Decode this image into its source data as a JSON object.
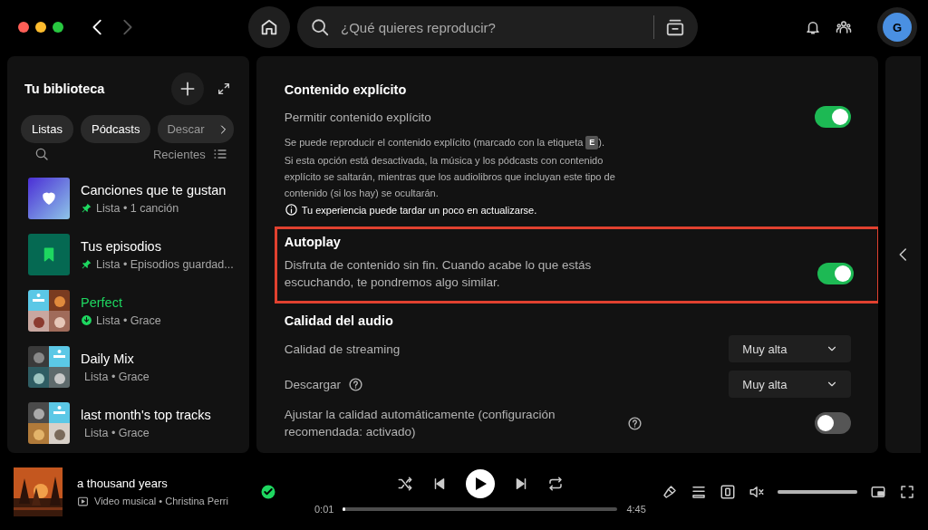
{
  "topbar": {
    "nav": [
      {
        "kind": "back",
        "disabled": false
      },
      {
        "kind": "forward",
        "disabled": true
      }
    ],
    "search": {
      "placeholder": "¿Qué quieres reproducir?"
    },
    "avatar": "G"
  },
  "library": {
    "title": "Tu biblioteca",
    "filters": [
      {
        "label": "Listas",
        "selected": false
      },
      {
        "label": "Pódcasts",
        "selected": false
      },
      {
        "label": "Descar",
        "selected": false
      }
    ],
    "sort": "Recientes",
    "items": [
      {
        "title": "Canciones que te gustan",
        "subtitle": "Lista • 1 canción",
        "kind": "liked",
        "pinned": true,
        "downloaded": false,
        "playing": false
      },
      {
        "title": "Tus episodios",
        "subtitle": "Lista • Episodios guardad...",
        "kind": "episodes",
        "pinned": true,
        "downloaded": false,
        "playing": false
      },
      {
        "title": "Perfect",
        "subtitle": "Lista • Grace",
        "kind": "picture",
        "pinned": false,
        "downloaded": true,
        "playing": true
      },
      {
        "title": "Daily Mix",
        "subtitle": "Lista • Grace",
        "kind": "picture",
        "pinned": false,
        "downloaded": false,
        "playing": false
      },
      {
        "title": "last month's top tracks",
        "subtitle": "Lista • Grace",
        "kind": "picture",
        "pinned": false,
        "downloaded": false,
        "playing": false
      }
    ]
  },
  "settings": {
    "sections": [
      {
        "title": "Contenido explícito",
        "highlighted": false,
        "items": [
          {
            "kind": "toggle",
            "label": "Permitir contenido explícito",
            "on": true,
            "help": false
          },
          {
            "kind": "badge_note",
            "before": "Se puede reproducir el contenido explícito (marcado con la etiqueta",
            "badge": "E",
            "after": ")."
          },
          {
            "kind": "note",
            "text": "Si esta opción está desactivada, la música y los pódcasts con contenido explícito se saltarán, mientras que los audiolibros que incluyan este tipo de contenido (si los hay) se ocultarán."
          },
          {
            "kind": "info",
            "text": "Tu experiencia puede tardar un poco en actualizarse."
          }
        ]
      },
      {
        "title": "Autoplay",
        "highlighted": true,
        "items": [
          {
            "kind": "toggle",
            "label": "Disfruta de contenido sin fin. Cuando acabe lo que estás escuchando, te pondremos algo similar.",
            "on": true,
            "help": false
          }
        ]
      },
      {
        "title": "Calidad del audio",
        "highlighted": false,
        "items": [
          {
            "kind": "select",
            "label": "Calidad de streaming",
            "value": "Muy alta",
            "help": false
          },
          {
            "kind": "select",
            "label": "Descargar",
            "value": "Muy alta",
            "help": true
          },
          {
            "kind": "toggle",
            "label": "Ajustar la calidad automáticamente (configuración recomendada: activado)",
            "on": false,
            "help": true
          }
        ]
      }
    ]
  },
  "player": {
    "title": "a thousand years",
    "subtitle": "Video musical • Christina Perri",
    "saved": true,
    "playing": false,
    "elapsed": "0:01",
    "duration": "4:45",
    "progress": {
      "level": 0.01
    },
    "volume": {
      "level": 1,
      "muted": true
    }
  }
}
